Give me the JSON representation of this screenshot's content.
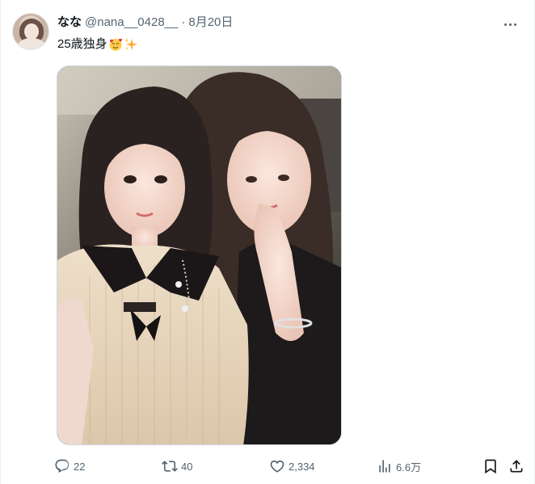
{
  "author": {
    "display_name": "なな",
    "handle": "@nana__0428__",
    "separator": "·",
    "date": "8月20日"
  },
  "tweet": {
    "text": "25歳独身",
    "emojis": [
      "smiling-face-with-hearts-emoji",
      "sparkles-emoji"
    ]
  },
  "media": {
    "alt": "Two women taking a selfie"
  },
  "actions": {
    "reply_count": "22",
    "repost_count": "40",
    "like_count": "2,334",
    "view_count": "6.6万"
  },
  "icons": {
    "reply": "reply-icon",
    "repost": "repost-icon",
    "like": "like-icon",
    "views": "views-icon",
    "bookmark": "bookmark-icon",
    "share": "share-icon",
    "more": "more-icon"
  },
  "colors": {
    "text": "#0f1419",
    "secondary": "#536471",
    "border": "#cfd9de"
  }
}
